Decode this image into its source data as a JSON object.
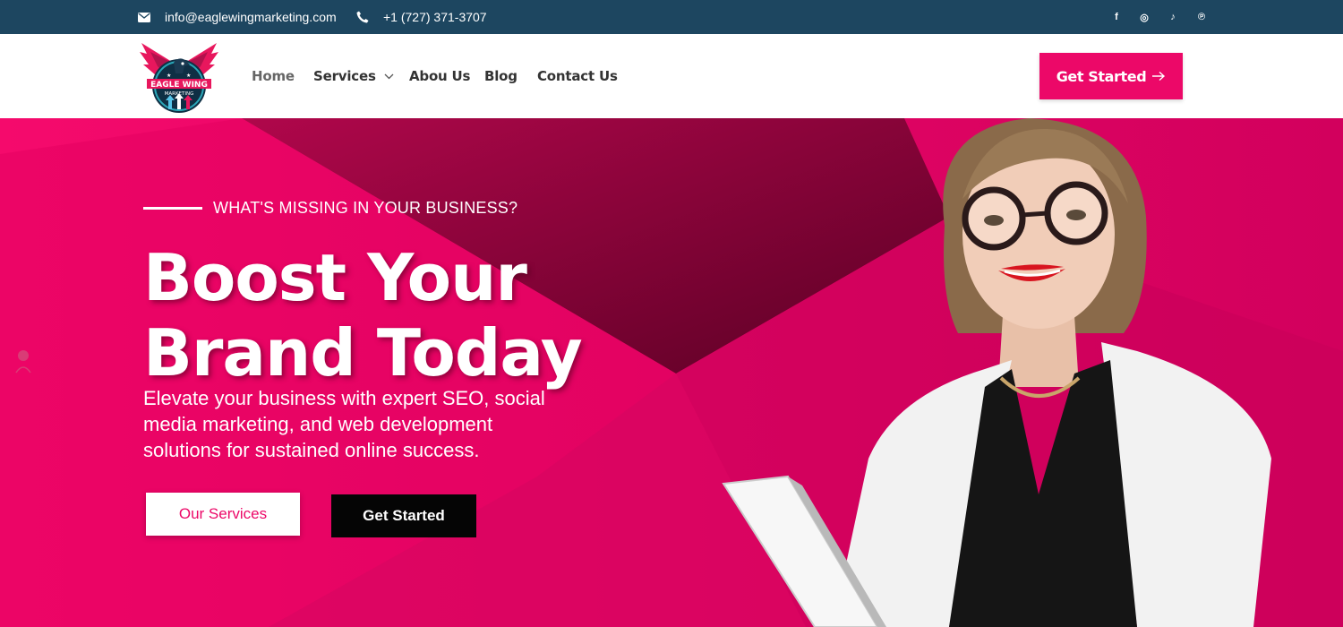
{
  "topbar": {
    "email": "info@eaglewingmarketing.com",
    "phone": "+1 (727) 371-3707",
    "email_icon": "envelope-icon",
    "phone_icon": "phone-icon",
    "social": [
      {
        "name": "facebook-icon",
        "glyph": "f"
      },
      {
        "name": "instagram-icon",
        "glyph": "◎"
      },
      {
        "name": "tiktok-icon",
        "glyph": "♪"
      },
      {
        "name": "pinterest-icon",
        "glyph": "℗"
      }
    ]
  },
  "logo": {
    "line1": "EAGLE WING",
    "line2": "MARKETING"
  },
  "nav": {
    "home": "Home",
    "services": "Services",
    "about": "Abou Us",
    "blog": "Blog",
    "contact": "Contact Us",
    "cta": "Get Started"
  },
  "hero": {
    "eyebrow": "WHAT'S MISSING IN YOUR BUSINESS?",
    "headline_line1": "Boost Your",
    "headline_line2": "Brand Today",
    "subtext": "Elevate your business with expert SEO, social media marketing, and web development solutions for sustained online success.",
    "btn_services": "Our Services",
    "btn_start": "Get Started"
  },
  "colors": {
    "topbar": "#1d4660",
    "accent": "#ec0868",
    "hero_dark": "#7a0030",
    "button_dark": "#050505"
  }
}
